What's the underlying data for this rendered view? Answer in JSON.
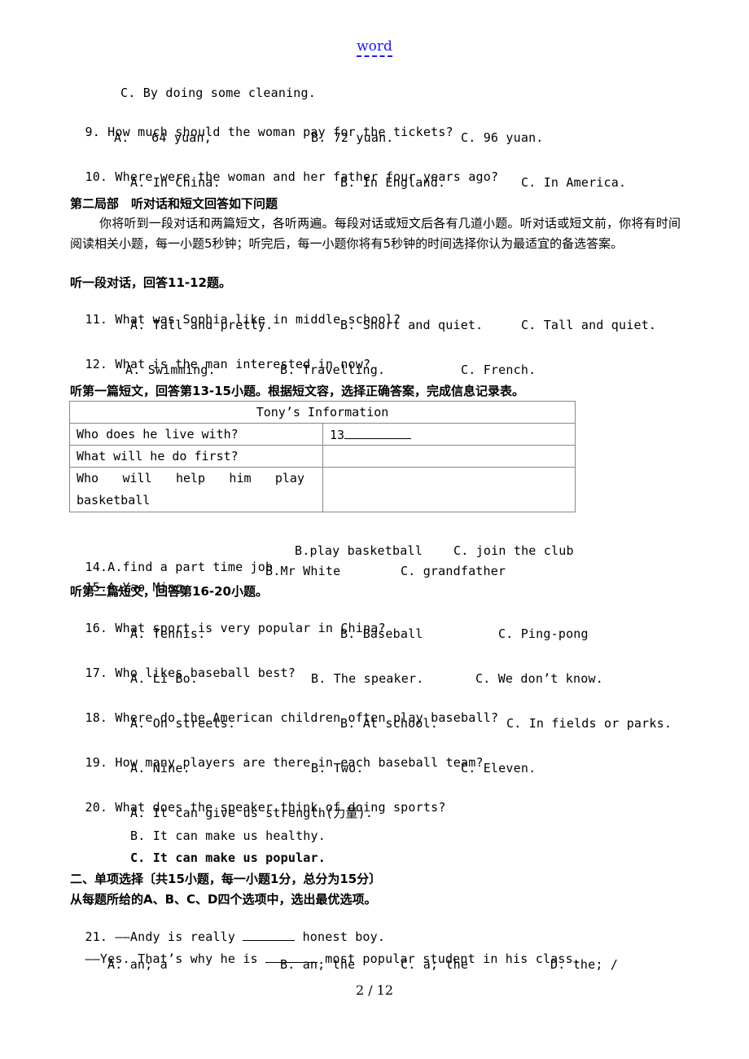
{
  "header": {
    "link_text": "word"
  },
  "q8_tail": {
    "option_c": "C. By doing some cleaning."
  },
  "questions_part1": [
    {
      "number": "9.",
      "text": "How much should the woman pay for the tickets?",
      "options": [
        "A.   64 yuan,",
        "B. 72 yuan.",
        "C. 96 yuan."
      ]
    },
    {
      "number": "10.",
      "text": "Where were the woman and her father four years ago?",
      "options": [
        "A. In China.",
        "B. In England.",
        "C. In America."
      ]
    }
  ],
  "section2": {
    "heading": "第二局部　听对话和短文回答如下问题",
    "instructions": "你将听到一段对话和两篇短文，各听两遍。每段对话或短文后各有几道小题。听对话或短文前，你将有时间阅读相关小题，每一小题5秒钟；听完后，每一小题你将有5秒钟的时间选择你认为最适宜的备选答案。",
    "dialogue_heading": "听一段对话，回答11-12题。",
    "dialogue_questions": [
      {
        "number": "11.",
        "text": "What was Sophia like in middle school?",
        "options": [
          "A. Tall and pretty.",
          "B. Short and quiet.",
          "C. Tall and quiet."
        ]
      },
      {
        "number": "12.",
        "text": "What is the man interested in now?",
        "options": [
          "A. Swimming.",
          "B. Travelling.",
          "C. French."
        ]
      }
    ],
    "passage1_heading": "听第一篇短文，回答第13-15小题。根据短文容，选择正确答案，完成信息记录表。",
    "info_table": {
      "title": "Tony’s Information",
      "rows": [
        {
          "question": "Who does he live with?",
          "answer_prefix": "13"
        },
        {
          "question": "What will he do first?",
          "answer_prefix": ""
        },
        {
          "question_words": [
            "Who",
            "will",
            "help",
            "him",
            "play"
          ],
          "question_tail": "basketball",
          "answer_prefix": ""
        }
      ]
    },
    "table_questions": [
      {
        "number": "14.",
        "options": [
          "A.find a part time job",
          "B.play basketball",
          "C. join the club"
        ]
      },
      {
        "number": "15.",
        "options": [
          "A.Yao Ming",
          "B.Mr White",
          "C. grandfather"
        ]
      }
    ],
    "passage2_heading": "听第二篇短文，回答第16-20小题。",
    "passage2_questions": [
      {
        "number": "16.",
        "text": "What sport is very popular in China?",
        "options": [
          "A. Tennis.",
          "B. Baseball",
          "C. Ping-pong"
        ]
      },
      {
        "number": "17.",
        "text": "Who likes baseball best?",
        "options": [
          "A. Li Bo.",
          "B. The speaker.",
          "C. We don’t know."
        ]
      },
      {
        "number": "18.",
        "text": "Where do the American children often play baseball?",
        "options": [
          "A. On streets.",
          "B. At school.",
          "C. In fields or parks."
        ]
      },
      {
        "number": "19.",
        "text": "How many players are there in each baseball team?",
        "options": [
          "A. Nine.",
          "B. Two.",
          "C. Eleven."
        ]
      },
      {
        "number": "20.",
        "text": "What does the speaker think of doing sports?",
        "options": [
          "A. It can give us strength(力量).",
          "B. It can make us healthy.",
          "C. It can make us popular."
        ]
      }
    ]
  },
  "section_choice": {
    "heading": "二、单项选择〔共15小题，每一小题1分，总分为15分〕",
    "instruction": "从每题所给的A、B、C、D四个选项中，选出最优选项。",
    "q21": {
      "number": "21.",
      "line1_prefix": "——Andy is really",
      "line1_suffix": "honest boy.",
      "line2_prefix": "——Yes. That’s why he is",
      "line2_suffix": "most popular student in his class.",
      "options": [
        "A. an; a",
        "B. an; the",
        "C. a; the",
        "D. the; /"
      ]
    }
  },
  "footer": {
    "page_number": "2 / 12"
  }
}
